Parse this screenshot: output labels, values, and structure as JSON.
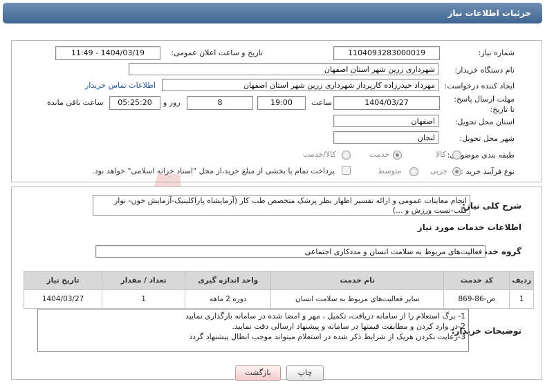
{
  "header": {
    "title": "جزئیات اطلاعات نیاز"
  },
  "need": {
    "number_label": "شماره نیاز:",
    "number_value": "1104093283000019",
    "announce_label": "تاریخ و ساعت اعلان عمومی:",
    "announce_value": "1404/03/19 - 11:49",
    "buyer_label": "نام دستگاه خریدار:",
    "buyer_value": "شهرداری زرین شهر استان اصفهان",
    "creator_label": "ایجاد کننده درخواست:",
    "creator_value": "مهرداد حیدرزاده کارپرداز شهرداری زرین شهر استان اصفهان",
    "contact_link": "اطلاعات تماس خریدار",
    "deadline_label": "مهلت ارسال پاسخ: تا تاریخ:",
    "deadline_date": "1404/03/27",
    "time_label": "ساعت",
    "deadline_time": "19:00",
    "days_value": "8",
    "days_label": "روز و",
    "remaining_time": "05:25:20",
    "remaining_label": "ساعت باقی مانده",
    "province_label": "استان محل تحویل:",
    "province_value": "اصفهان",
    "city_label": "شهر محل تحویل:",
    "city_value": "لنجان",
    "category_label": "طبقه بندی موضوعی:",
    "category_options": [
      "کالا",
      "خدمت",
      "کالا/خدمت"
    ],
    "category_selected": "خدمت",
    "process_label": "نوع فرآیند خرید :",
    "process_options": [
      "جزیی",
      "متوسط"
    ],
    "process_selected": "جزیی",
    "payment_note": "پرداخت تمام یا بخشی از مبلغ خرید،از محل \"اسناد خزانه اسلامی\" خواهد بود."
  },
  "description": {
    "label": "شرح کلی نیاز:",
    "text": "انجام معاینات عمومی و ارائه تفسیر اظهار نظر پزشک متخصص طب کار (آزمایشاه پاراکلینیک-آزمایش خون- نوار قلب-تست ورزش و ...)"
  },
  "services": {
    "heading": "اطلاعات خدمات مورد نیاز",
    "group_label": "گروه خدمت:",
    "group_value": "فعالیت‌های مربوط به سلامت انسان و مددکاری اجتماعی",
    "columns": [
      "ردیف",
      "کد خدمت",
      "نام خدمت",
      "واحد اندازه گیری",
      "تعداد / مقدار",
      "تاریخ نیاز"
    ],
    "rows": [
      [
        "1",
        "ص-86-869",
        "سایر فعالیت‌های مربوط به سلامت انسان",
        "دوره 2 ماهه",
        "1",
        "1404/03/27"
      ]
    ]
  },
  "buyer_notes": {
    "label": "توضیحات خریدار:",
    "lines": [
      "1- برگ استعلام را از سامانه دریافت، تکمیل ، مهر و امضا شده در سامانه بارگذاری نمایید",
      "2-در وارد کردن و مطابقت قیمتها در سامانه و پیشنهاد ارسالی دقت نمایید.",
      "3-رعایت نکردن هریک از شرایط  ذکر شده در استعلام میتواند موجب ابطال پیشنهاد گردد"
    ]
  },
  "buttons": {
    "print": "چاپ",
    "back": "بازگشت"
  },
  "watermark": "AriaTender.net"
}
